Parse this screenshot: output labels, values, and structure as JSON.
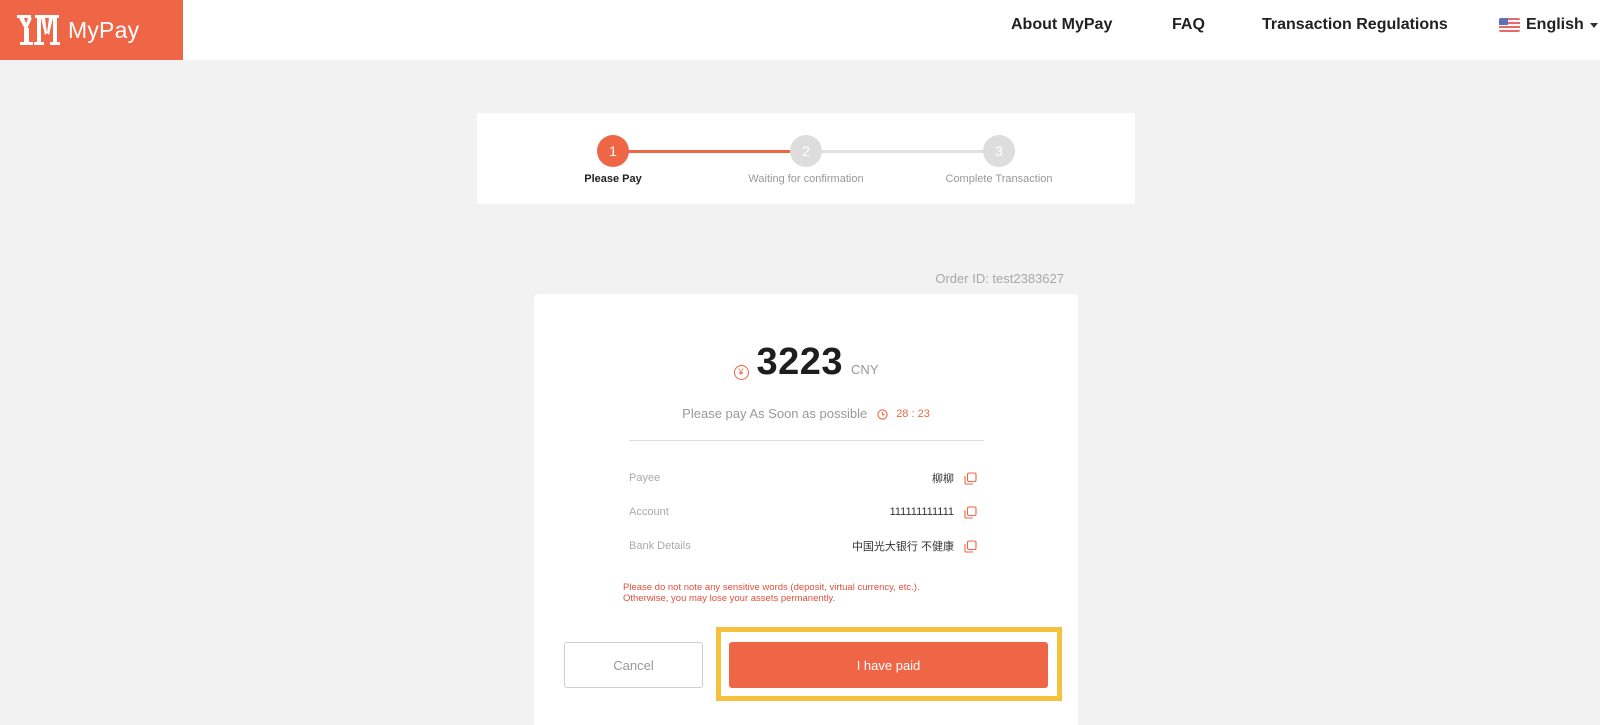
{
  "brand": {
    "name": "MyPay",
    "color": "#ee6646",
    "logo_icon": "mypay-logo-icon"
  },
  "nav": {
    "about": "About MyPay",
    "faq": "FAQ",
    "regulations": "Transaction Regulations",
    "language": "English",
    "language_icon": "us-flag-icon"
  },
  "steps": [
    {
      "number": "1",
      "label": "Please Pay",
      "state": "active"
    },
    {
      "number": "2",
      "label": "Waiting for confirmation",
      "state": "pending"
    },
    {
      "number": "3",
      "label": "Complete Transaction",
      "state": "pending"
    }
  ],
  "order": {
    "id_text": "Order ID: test2383627"
  },
  "payment": {
    "currency_symbol": "¥",
    "amount": "3223",
    "currency": "CNY",
    "instruction": "Please pay As Soon as possible",
    "timer": "28 : 23"
  },
  "details": [
    {
      "label": "Payee",
      "value": "柳柳"
    },
    {
      "label": "Account",
      "value": "111111111111"
    },
    {
      "label": "Bank Details",
      "value": "中国光大银行 不健康"
    }
  ],
  "warning": {
    "line1": "Please do not note any sensitive words (deposit, virtual currency, etc.).",
    "line2": "Otherwise, you may lose your assets permanently."
  },
  "buttons": {
    "cancel": "Cancel",
    "paid": "I have paid"
  },
  "colors": {
    "accent": "#ee6646",
    "highlight": "#f5c23e",
    "background": "#f2f2f2"
  }
}
